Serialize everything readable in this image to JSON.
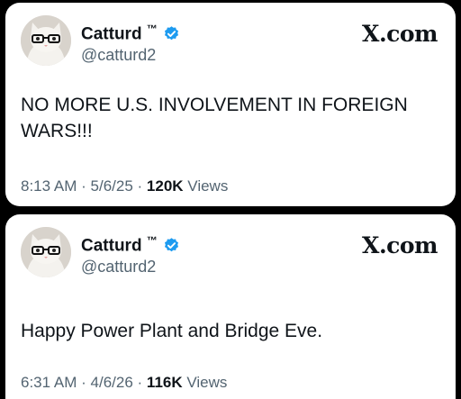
{
  "tweets": [
    {
      "author": "Catturd",
      "trademark": "™",
      "handle": "@catturd2",
      "brand": "X.com",
      "text": "NO MORE U.S. INVOLVEMENT IN FOREIGN WARS!!!",
      "time": "8:13 AM",
      "date": "5/6/25",
      "views_count": "120K",
      "views_label": "Views",
      "separator": "·"
    },
    {
      "author": "Catturd",
      "trademark": "™",
      "handle": "@catturd2",
      "brand": "X.com",
      "text": "Happy Power Plant and Bridge Eve.",
      "time": "6:31 AM",
      "date": "4/6/26",
      "views_count": "116K",
      "views_label": "Views",
      "separator": "·"
    }
  ],
  "colors": {
    "verified": "#1d9bf0",
    "secondary_text": "#536471",
    "primary_text": "#0f1419"
  },
  "icons": [
    "cat-avatar-icon",
    "verified-badge-icon"
  ]
}
